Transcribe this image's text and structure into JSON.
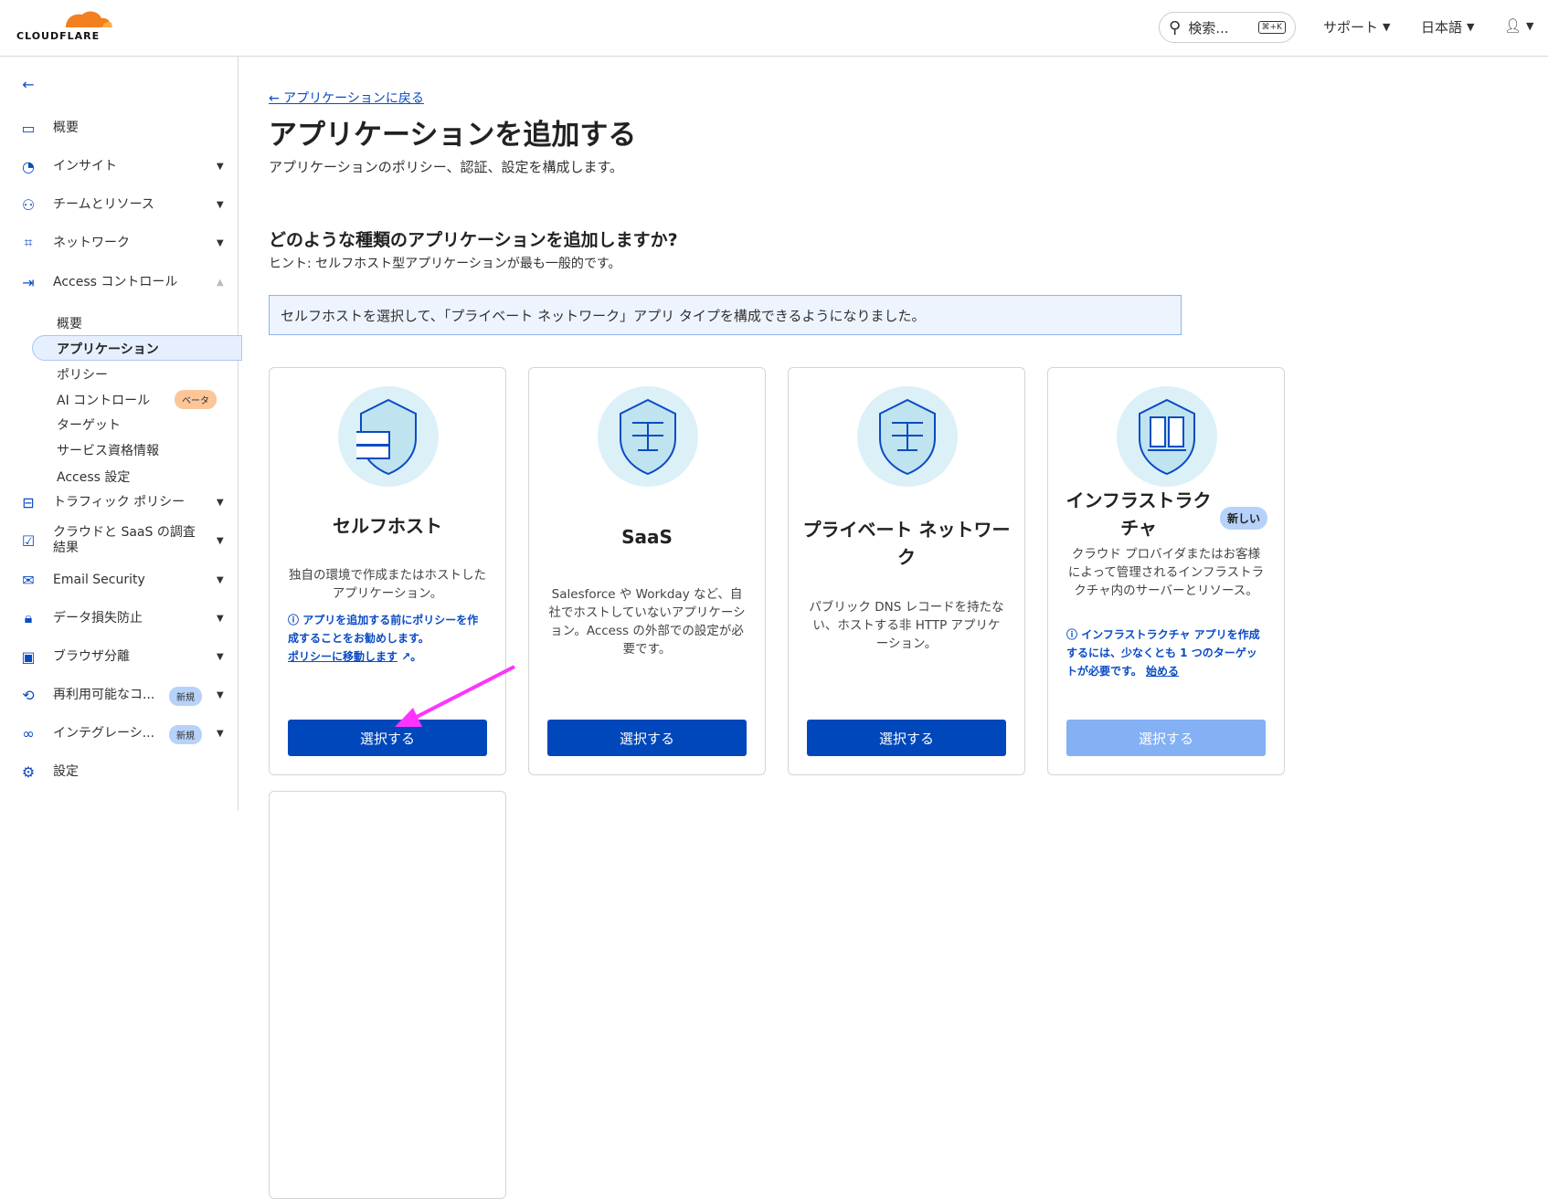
{
  "header": {
    "logo": "CLOUDFLARE",
    "search_placeholder": "検索...",
    "search_shortcut": "⌘+K",
    "support": "サポート",
    "language": "日本語"
  },
  "sidebar": {
    "items": [
      {
        "label": "概要",
        "icon": "overview-icon"
      },
      {
        "label": "インサイト",
        "icon": "pie-chart-icon"
      },
      {
        "label": "チームとリソース",
        "icon": "team-icon"
      },
      {
        "label": "ネットワーク",
        "icon": "network-icon"
      },
      {
        "label": "Access コントロール",
        "icon": "access-icon"
      },
      {
        "label": "トラフィック ポリシー",
        "icon": "traffic-icon"
      },
      {
        "label": "クラウドと SaaS の調査結果",
        "icon": "cloud-scan-icon"
      },
      {
        "label": "Email Security",
        "icon": "email-security-icon"
      },
      {
        "label": "データ損失防止",
        "icon": "dlp-icon"
      },
      {
        "label": "ブラウザ分離",
        "icon": "browser-icon"
      },
      {
        "label": "再利用可能なコ...",
        "icon": "reusable-icon",
        "badge": "新規"
      },
      {
        "label": "インテグレーシ...",
        "icon": "integration-icon",
        "badge": "新規"
      },
      {
        "label": "設定",
        "icon": "gear-icon"
      }
    ],
    "access_sub": [
      "概要",
      "アプリケーション",
      "ポリシー",
      "AI コントロール",
      "ターゲット",
      "サービス資格情報",
      "Access 設定"
    ],
    "beta_badge": "ベータ"
  },
  "main": {
    "back_link": "← アプリケーションに戻る",
    "title": "アプリケーションを追加する",
    "subtitle": "アプリケーションのポリシー、認証、設定を構成します。",
    "question": "どのような種類のアプリケーションを追加しますか?",
    "hint": "ヒント: セルフホスト型アプリケーションが最も一般的です。",
    "info": "セルフホストを選択して、「プライベート ネットワーク」アプリ タイプを構成できるようになりました。",
    "cards": [
      {
        "title": "セルフホスト",
        "desc": "独自の環境で作成またはホストしたアプリケーション。",
        "note": "アプリを追加する前にポリシーを作成することをお勧めします。",
        "link": "ポリシーに移動します",
        "button": "選択する"
      },
      {
        "title": "SaaS",
        "desc": "Salesforce や Workday など、自社でホストしていないアプリケーション。Access の外部での設定が必要です。",
        "button": "選択する"
      },
      {
        "title": "プライベート ネットワーク",
        "desc": "パブリック DNS レコードを持たない、ホストする非 HTTP アプリケーション。",
        "button": "選択する"
      },
      {
        "title": "インフラストラクチャ",
        "badge": "新しい",
        "desc": "クラウド プロバイダまたはお客様によって管理されるインフラストラクチャ内のサーバーとリソース。",
        "note": "インフラストラクチャ アプリを作成するには、少なくとも 1 つのターゲットが必要です。",
        "link": "始める",
        "button": "選択する"
      }
    ]
  },
  "colors": {
    "primary": "#0047bb",
    "annotation": "#ff33ff",
    "orange": "#f38020"
  }
}
